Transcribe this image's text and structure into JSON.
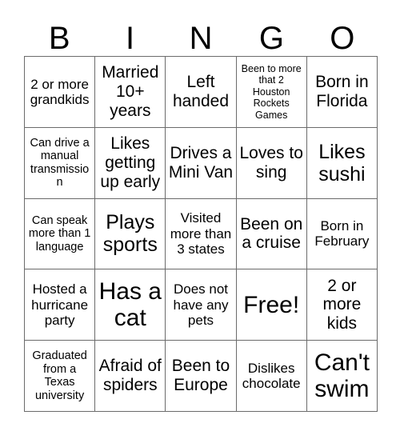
{
  "card": {
    "title": "BINGO",
    "header_letters": [
      "B",
      "I",
      "N",
      "G",
      "O"
    ],
    "grid_size": "5x5",
    "free_space_index": 12,
    "colors": {
      "background": "#ffffff",
      "text": "#000000",
      "grid_line": "#6b6b6b"
    },
    "cells": [
      {
        "text": "2 or more grandkids",
        "size": "fs-m",
        "free": false
      },
      {
        "text": "Married 10+ years",
        "size": "fs-l",
        "free": false
      },
      {
        "text": "Left handed",
        "size": "fs-l",
        "free": false
      },
      {
        "text": "Been to more that 2 Houston Rockets Games",
        "size": "fs-xs",
        "free": false
      },
      {
        "text": "Born in Florida",
        "size": "fs-l",
        "free": false
      },
      {
        "text": "Can drive a manual transmission",
        "size": "fs-s",
        "free": false
      },
      {
        "text": "Likes getting up early",
        "size": "fs-l",
        "free": false
      },
      {
        "text": "Drives a Mini Van",
        "size": "fs-l",
        "free": false
      },
      {
        "text": "Loves to sing",
        "size": "fs-l",
        "free": false
      },
      {
        "text": "Likes sushi",
        "size": "fs-xl",
        "free": false
      },
      {
        "text": "Can speak more than 1 language",
        "size": "fs-s",
        "free": false
      },
      {
        "text": "Plays sports",
        "size": "fs-xl",
        "free": false
      },
      {
        "text": "Visited more than 3 states",
        "size": "fs-m",
        "free": false
      },
      {
        "text": "Been on a cruise",
        "size": "fs-l",
        "free": false
      },
      {
        "text": "Born in February",
        "size": "fs-m",
        "free": false
      },
      {
        "text": "Hosted a hurricane party",
        "size": "fs-m",
        "free": false
      },
      {
        "text": "Has a cat",
        "size": "fs-xxl",
        "free": false
      },
      {
        "text": "Does not have any pets",
        "size": "fs-m",
        "free": false
      },
      {
        "text": "Free!",
        "size": "fs-xxl",
        "free": true
      },
      {
        "text": "2 or more kids",
        "size": "fs-l",
        "free": false
      },
      {
        "text": "Graduated from a Texas university",
        "size": "fs-s",
        "free": false
      },
      {
        "text": "Afraid of spiders",
        "size": "fs-l",
        "free": false
      },
      {
        "text": "Been to Europe",
        "size": "fs-l",
        "free": false
      },
      {
        "text": "Dislikes chocolate",
        "size": "fs-m",
        "free": false
      },
      {
        "text": "Can't swim",
        "size": "fs-xxl",
        "free": false
      }
    ]
  }
}
